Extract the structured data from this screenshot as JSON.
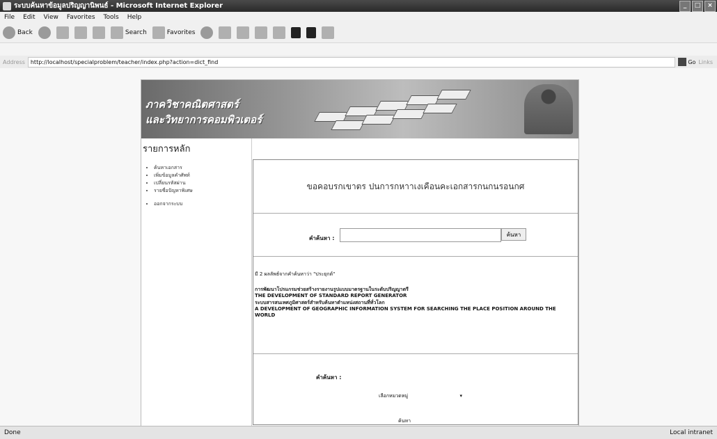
{
  "window": {
    "title": "ระบบค้นหาข้อมูลปริญญานิพนธ์ - Microsoft Internet Explorer",
    "buttons": [
      "_",
      "□",
      "×"
    ]
  },
  "menu": [
    "File",
    "Edit",
    "View",
    "Favorites",
    "Tools",
    "Help"
  ],
  "toolbar": {
    "back_label": "Back",
    "search_label": "Search",
    "favorites_label": "Favorites"
  },
  "address": {
    "label": "Address",
    "url": "http://localhost/specialproblem/teacher/index.php?action=dict_find",
    "go_label": "Go",
    "links_label": "Links"
  },
  "banner": {
    "line1": "ภาควิชาคณิตศาสตร์",
    "line2": "และวิทยาการคอมพิวเตอร์"
  },
  "sidebar": {
    "heading": "รายการหลัก",
    "items": [
      "ค้นหาเอกสาร",
      "เพิ่มข้อมูลคำศัพท์",
      "เปลี่ยนรหัสผ่าน",
      "รายชื่อปัญหาพิเศษ",
      "ออกจากระบบ"
    ]
  },
  "main": {
    "heading": "ขอคอบรกเขาตร ปนการกหาาเงเคือนคะเอกสารกนกนรอนกศ",
    "search_label": "คำค้นหา :",
    "search_button": "ค้นหา",
    "result_summary": "มี 2 ผลลัพธ์จากคำค้นหาว่า \"ประยุกต์\"",
    "results": [
      {
        "thai": "การพัฒนาโปรแกรมช่วยสร้างรายงานรูปแบบมาตรฐานในระดับปริญญาตรี",
        "en": "THE DEVELOPMENT OF STANDARD REPORT GENERATOR"
      },
      {
        "thai": "ระบบสารสนเทศภูมิศาสตร์สำหรับค้นหาตำแหน่งสถานที่ทั่วโลก",
        "en": "A DEVELOPMENT OF GEOGRAPHIC INFORMATION SYSTEM FOR SEARCHING THE PLACE POSITION AROUND THE WORLD"
      }
    ],
    "form2_label": "คำค้นหา :",
    "select_value": "เลือกหมวดหมู่",
    "form2_button": "ค้นหา"
  },
  "status": {
    "left": "Done",
    "right": "Local intranet"
  }
}
